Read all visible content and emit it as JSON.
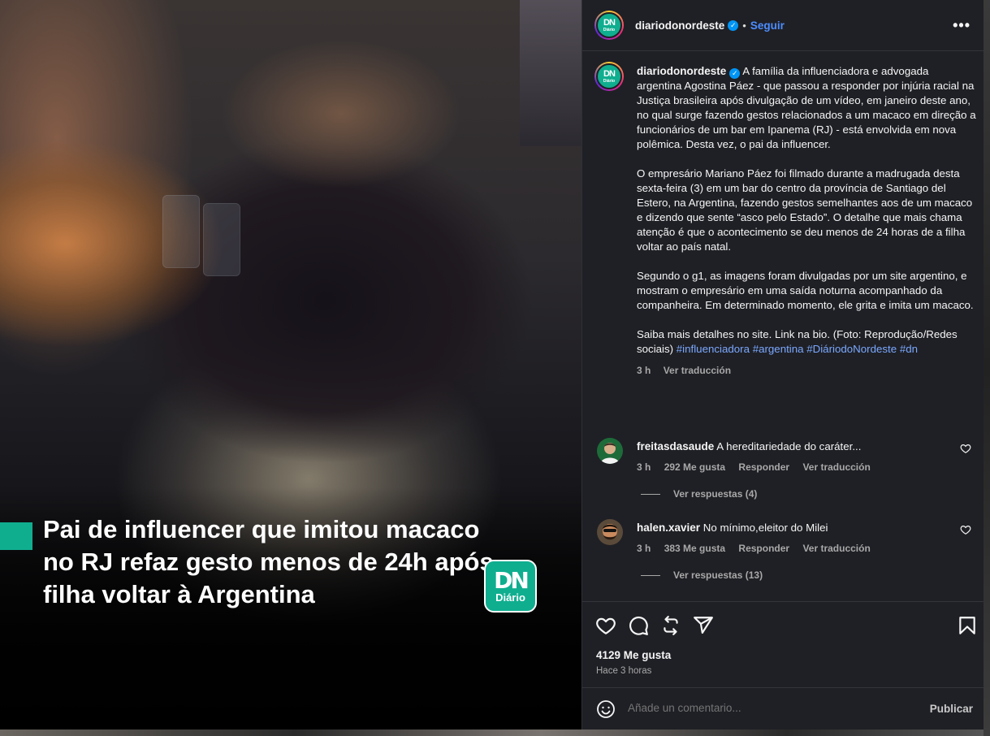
{
  "media": {
    "caption": "Pai de influencer que imitou macaco no RJ refaz gesto menos de 24h após filha voltar à Argentina",
    "logo_main": "DN",
    "logo_sub": "Diário"
  },
  "header": {
    "username": "diariodonordeste",
    "separator": "•",
    "follow_label": "Seguir",
    "more_label": "•••"
  },
  "post": {
    "username": "diariodonordeste",
    "paragraphs": [
      "A família da influenciadora e advogada argentina Agostina Páez - que passou a responder por injúria racial na Justiça brasileira após divulgação de um vídeo, em janeiro deste ano, no qual surge fazendo gestos relacionados a um macaco em direção a funcionários de um bar em Ipanema (RJ) - está envolvida em nova polêmica. Desta vez, o pai da influencer.",
      "O empresário Mariano Páez foi filmado durante a madrugada desta sexta-feira (3) em um bar do centro da província de Santiago del Estero, na Argentina, fazendo gestos semelhantes aos de um macaco e dizendo que sente “asco pelo Estado”. O detalhe que mais chama atenção é que o acontecimento se deu menos de 24 horas de a filha voltar ao país natal.",
      "Segundo o g1, as imagens foram divulgadas por um site argentino, e mostram o empresário em uma saída noturna acompanhado da companheira. Em determinado momento, ele grita e imita um macaco."
    ],
    "closing_text": "Saiba mais detalhes no site. Link na bio. (Foto: Reprodução/Redes sociais)",
    "hashtags": [
      "#influenciadora",
      "#argentina",
      "#DiáriodoNordeste",
      "#dn"
    ],
    "time": "3 h",
    "translate_label": "Ver traducción"
  },
  "comments": [
    {
      "username": "freitasdasaude",
      "text": "A hereditariedade do caráter...",
      "time": "3 h",
      "likes": "292 Me gusta",
      "reply_label": "Responder",
      "translate_label": "Ver traducción",
      "replies_label": "Ver respuestas (4)"
    },
    {
      "username": "halen.xavier",
      "text": "No mínimo,eleitor do Milei",
      "time": "3 h",
      "likes": "383 Me gusta",
      "reply_label": "Responder",
      "translate_label": "Ver traducción",
      "replies_label": "Ver respuestas (13)"
    }
  ],
  "actions": {
    "likes": "4129 Me gusta",
    "time": "Hace 3 horas"
  },
  "comment_box": {
    "placeholder": "Añade un comentario...",
    "publish_label": "Publicar"
  },
  "icons": [
    "heart-icon",
    "comment-icon",
    "repost-icon",
    "share-icon",
    "bookmark-icon",
    "emoji-icon",
    "verified-icon",
    "more-icon"
  ],
  "colors": {
    "brand": "#0fae8f",
    "link": "#4c8dff",
    "hashtag": "#7aa8ff",
    "panel_bg": "#1f2025",
    "verified": "#0095f6"
  }
}
